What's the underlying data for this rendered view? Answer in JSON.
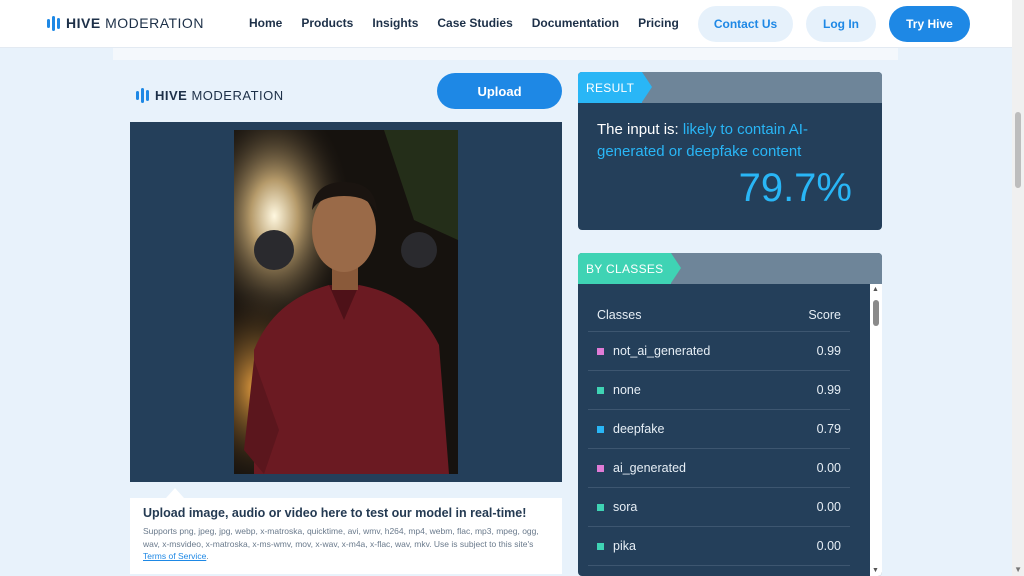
{
  "nav": {
    "brand_bold": "HIVE",
    "brand_rest": "MODERATION",
    "links": [
      "Home",
      "Products",
      "Insights",
      "Case Studies",
      "Documentation",
      "Pricing"
    ],
    "contact": "Contact Us",
    "login": "Log In",
    "try": "Try Hive"
  },
  "demo": {
    "brand_bold": "HIVE",
    "brand_rest": "MODERATION",
    "upload_label": "Upload",
    "info_title": "Upload image, audio or video here to test our model in real-time!",
    "info_body": "Supports png, jpeg, jpg, webp, x-matroska, quicktime, avi, wmv, h264, mp4, webm, flac, mp3, mpeg, ogg, wav, x-msvideo, x-matroska, x-ms-wmv, mov, x-wav, x-m4a, x-flac, wav, mkv. Use is subject to this site's ",
    "terms_link": "Terms of Service",
    "terms_end": "."
  },
  "result": {
    "tag": "RESULT",
    "prefix": "The input is: ",
    "verdict": "likely to contain AI-generated or deepfake content",
    "percent": "79.7%"
  },
  "classes": {
    "tag": "BY CLASSES",
    "col_class": "Classes",
    "col_score": "Score",
    "rows": [
      {
        "name": "not_ai_generated",
        "score": "0.99",
        "color": "#e07bd6"
      },
      {
        "name": "none",
        "score": "0.99",
        "color": "#3fd3b4"
      },
      {
        "name": "deepfake",
        "score": "0.79",
        "color": "#29b6f6"
      },
      {
        "name": "ai_generated",
        "score": "0.00",
        "color": "#e07bd6"
      },
      {
        "name": "sora",
        "score": "0.00",
        "color": "#3fd3b4"
      },
      {
        "name": "pika",
        "score": "0.00",
        "color": "#3fd3b4"
      }
    ]
  },
  "colors": {
    "accent": "#1e88e5",
    "result_blue": "#29b6f6",
    "classes_teal": "#3fd3b4",
    "card_bg": "#243f5a"
  }
}
